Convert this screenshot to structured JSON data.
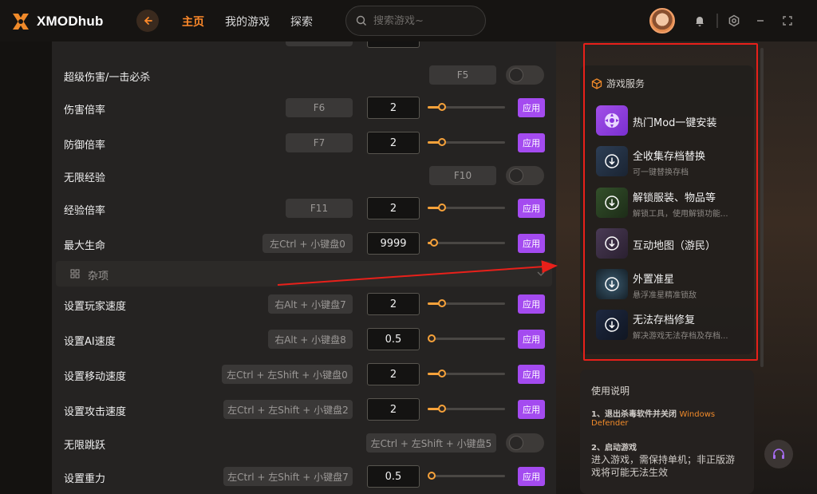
{
  "app": {
    "name": "XMODhub"
  },
  "nav": {
    "home": "主页",
    "my_games": "我的游戏",
    "explore": "探索"
  },
  "search": {
    "placeholder": "搜索游戏~",
    "icon": "search-icon"
  },
  "colors": {
    "accent": "#ff8a2a",
    "apply": "#a44bf0",
    "slider": "#f7a23a",
    "annotation": "#e8201a"
  },
  "rows": [
    {
      "label": "超级伤害/一击必杀",
      "hotkey": "F5",
      "type": "toggle",
      "on": false
    },
    {
      "label": "伤害倍率",
      "hotkey": "F6",
      "type": "slider",
      "value": "2",
      "level": 0.18,
      "apply": "应用"
    },
    {
      "label": "防御倍率",
      "hotkey": "F7",
      "type": "slider",
      "value": "2",
      "level": 0.18,
      "apply": "应用"
    },
    {
      "label": "无限经验",
      "hotkey": "F10",
      "type": "toggle",
      "on": false
    },
    {
      "label": "经验倍率",
      "hotkey": "F11",
      "type": "slider",
      "value": "2",
      "level": 0.18,
      "apply": "应用"
    },
    {
      "label": "最大生命",
      "hotkey": "左Ctrl + 小键盘0",
      "type": "slider",
      "value": "9999",
      "level": 0.07,
      "apply": "应用"
    }
  ],
  "section": {
    "label": "杂项"
  },
  "rows2": [
    {
      "label": "设置玩家速度",
      "hotkey": "右Alt + 小键盘7",
      "type": "slider",
      "value": "2",
      "level": 0.18,
      "apply": "应用"
    },
    {
      "label": "设置AI速度",
      "hotkey": "右Alt + 小键盘8",
      "type": "slider",
      "value": "0.5",
      "level": 0.0,
      "apply": "应用"
    },
    {
      "label": "设置移动速度",
      "hotkey": "左Ctrl + 左Shift + 小键盘0",
      "type": "slider",
      "value": "2",
      "level": 0.18,
      "apply": "应用"
    },
    {
      "label": "设置攻击速度",
      "hotkey": "左Ctrl + 左Shift + 小键盘2",
      "type": "slider",
      "value": "2",
      "level": 0.18,
      "apply": "应用"
    },
    {
      "label": "无限跳跃",
      "hotkey": "左Ctrl + 左Shift + 小键盘5",
      "type": "toggle",
      "on": false
    },
    {
      "label": "设置重力",
      "hotkey": "左Ctrl + 左Shift + 小键盘7",
      "type": "slider",
      "value": "0.5",
      "level": 0.0,
      "apply": "应用"
    }
  ],
  "services": {
    "title": "游戏服务",
    "items": [
      {
        "title": "热门Mod一键安装",
        "sub": ""
      },
      {
        "title": "全收集存档替换",
        "sub": "可一键替换存档"
      },
      {
        "title": "解锁服装、物品等",
        "sub": "解锁工具，使用解锁功能..."
      },
      {
        "title": "互动地图（游民）",
        "sub": ""
      },
      {
        "title": "外置准星",
        "sub": "悬浮准星精准锁敌"
      },
      {
        "title": "无法存档修复",
        "sub": "解决游戏无法存档及存档..."
      }
    ]
  },
  "usage": {
    "title": "使用说明",
    "step1_prefix": "1、退出杀毒软件并关闭",
    "step1_highlight": "Windows",
    "step1_highlight2": "Defender",
    "step2_title": "2、启动游戏",
    "step2_text": "进入游戏，需保持单机；非正版游",
    "step2_text2": "戏将可能无法生效"
  }
}
